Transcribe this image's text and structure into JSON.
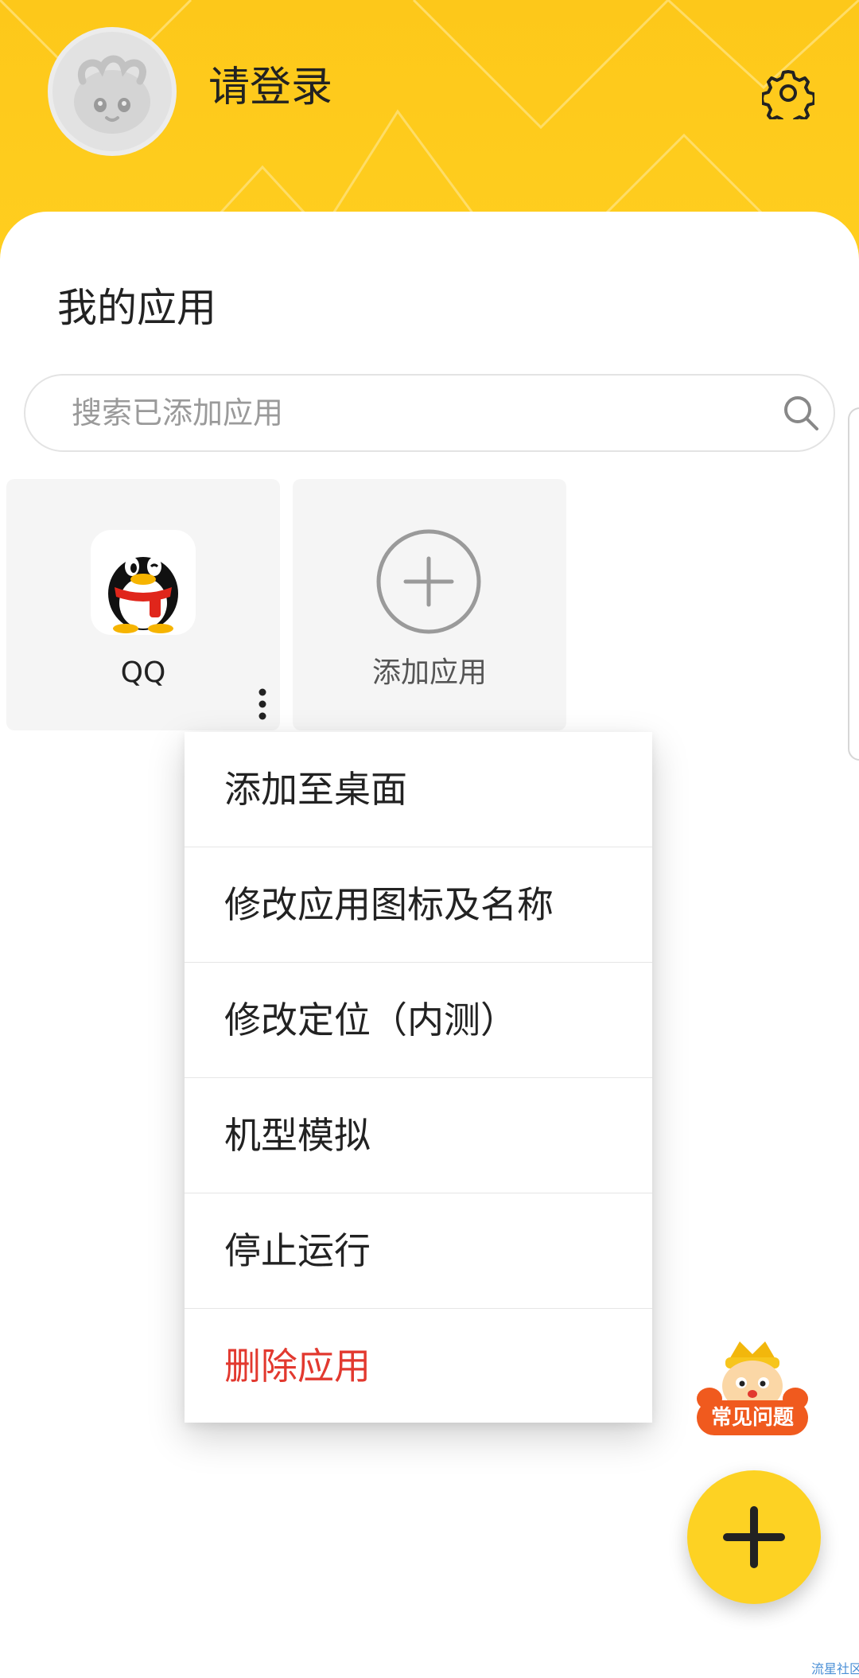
{
  "header": {
    "login_text": "请登录",
    "bg_color": "#fdc81a"
  },
  "section": {
    "title": "我的应用"
  },
  "search": {
    "placeholder": "搜索已添加应用"
  },
  "apps": [
    {
      "label": "QQ",
      "icon": "qq-penguin-icon"
    },
    {
      "label": "添加应用",
      "icon": "add-circle-icon"
    }
  ],
  "context_menu": {
    "items": [
      {
        "label": "添加至桌面"
      },
      {
        "label": "修改应用图标及名称"
      },
      {
        "label": "修改定位（内测）"
      },
      {
        "label": "机型模拟"
      },
      {
        "label": "停止运行"
      },
      {
        "label": "删除应用",
        "color": "#e2392f"
      }
    ]
  },
  "faq": {
    "label": "常见问题"
  },
  "fab": {
    "icon": "plus-icon",
    "color": "#fdd223"
  },
  "watermark": "流星社区"
}
